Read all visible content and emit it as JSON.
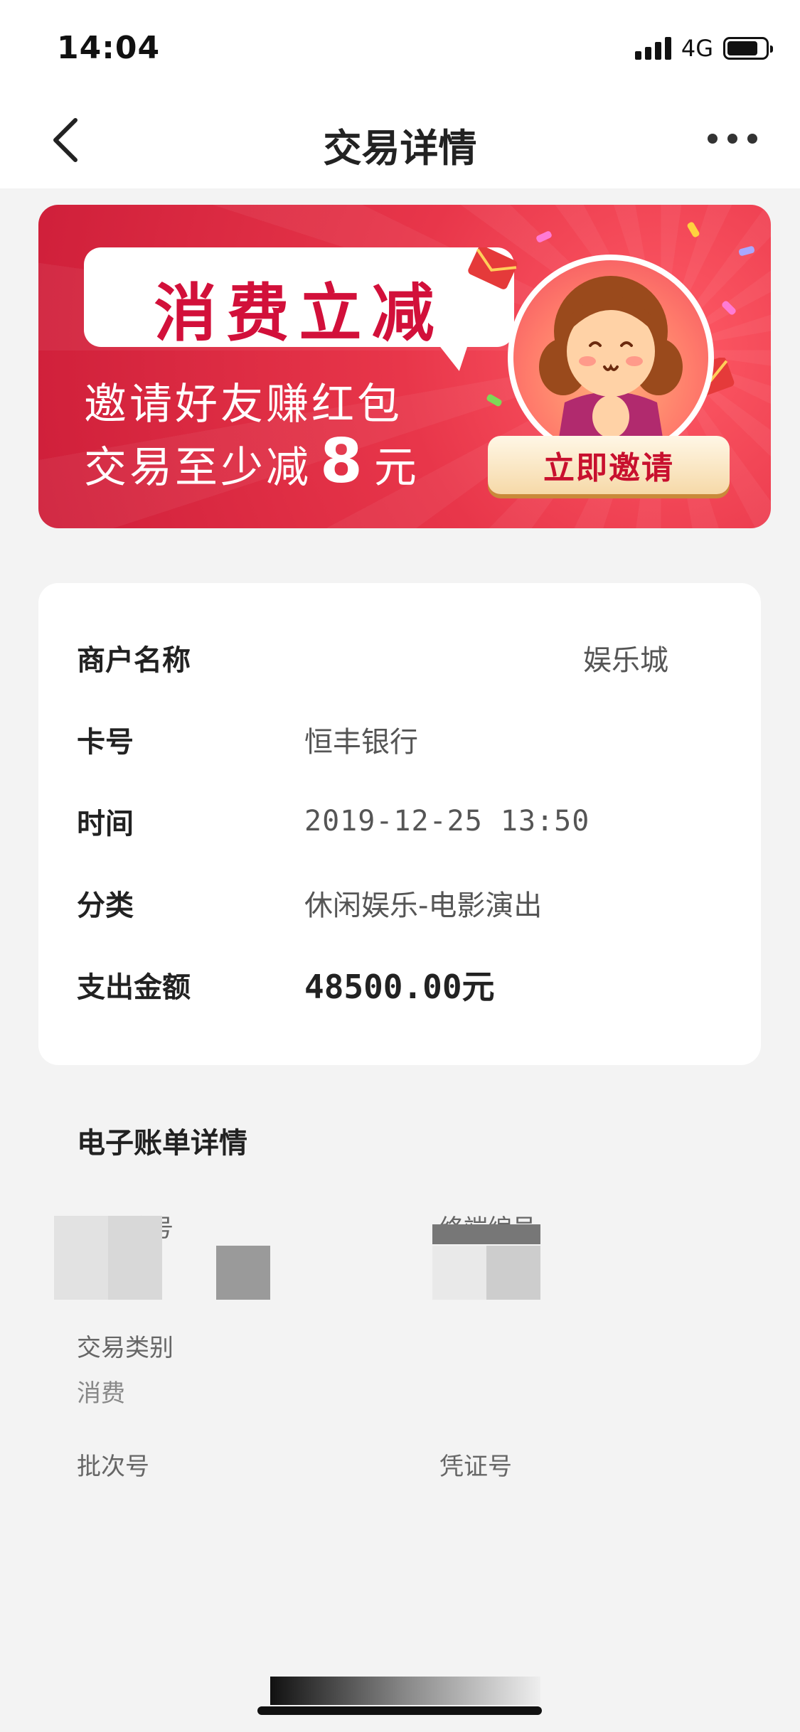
{
  "status_bar": {
    "time": "14:04",
    "network": "4G"
  },
  "nav": {
    "title": "交易详情",
    "back_icon": "chevron-left-icon",
    "more_icon": "more-horizontal-icon"
  },
  "banner": {
    "headline": "消费立减",
    "line1": "邀请好友赚红包",
    "line2_prefix": "交易至少减",
    "line2_amount": "8",
    "line2_suffix": "元",
    "button_label": "立即邀请"
  },
  "transaction": {
    "merchant_label": "商户名称",
    "merchant_value": "娱乐城",
    "card_label": "卡号",
    "card_value": "恒丰银行",
    "time_label": "时间",
    "time_value": "2019-12-25 13:50",
    "category_label": "分类",
    "category_value": "休闲娱乐-电影演出",
    "amount_label": "支出金额",
    "amount_value": "48500.00元"
  },
  "bill": {
    "title": "电子账单详情",
    "merchant_no_label": "商户编号",
    "terminal_no_label": "终端编号",
    "trade_type_label": "交易类别",
    "trade_type_value": "消费",
    "batch_no_label": "批次号",
    "voucher_no_label": "凭证号"
  },
  "colors": {
    "banner_red": "#e8364a",
    "accent_red": "#d2103a",
    "background": "#f3f3f3"
  }
}
